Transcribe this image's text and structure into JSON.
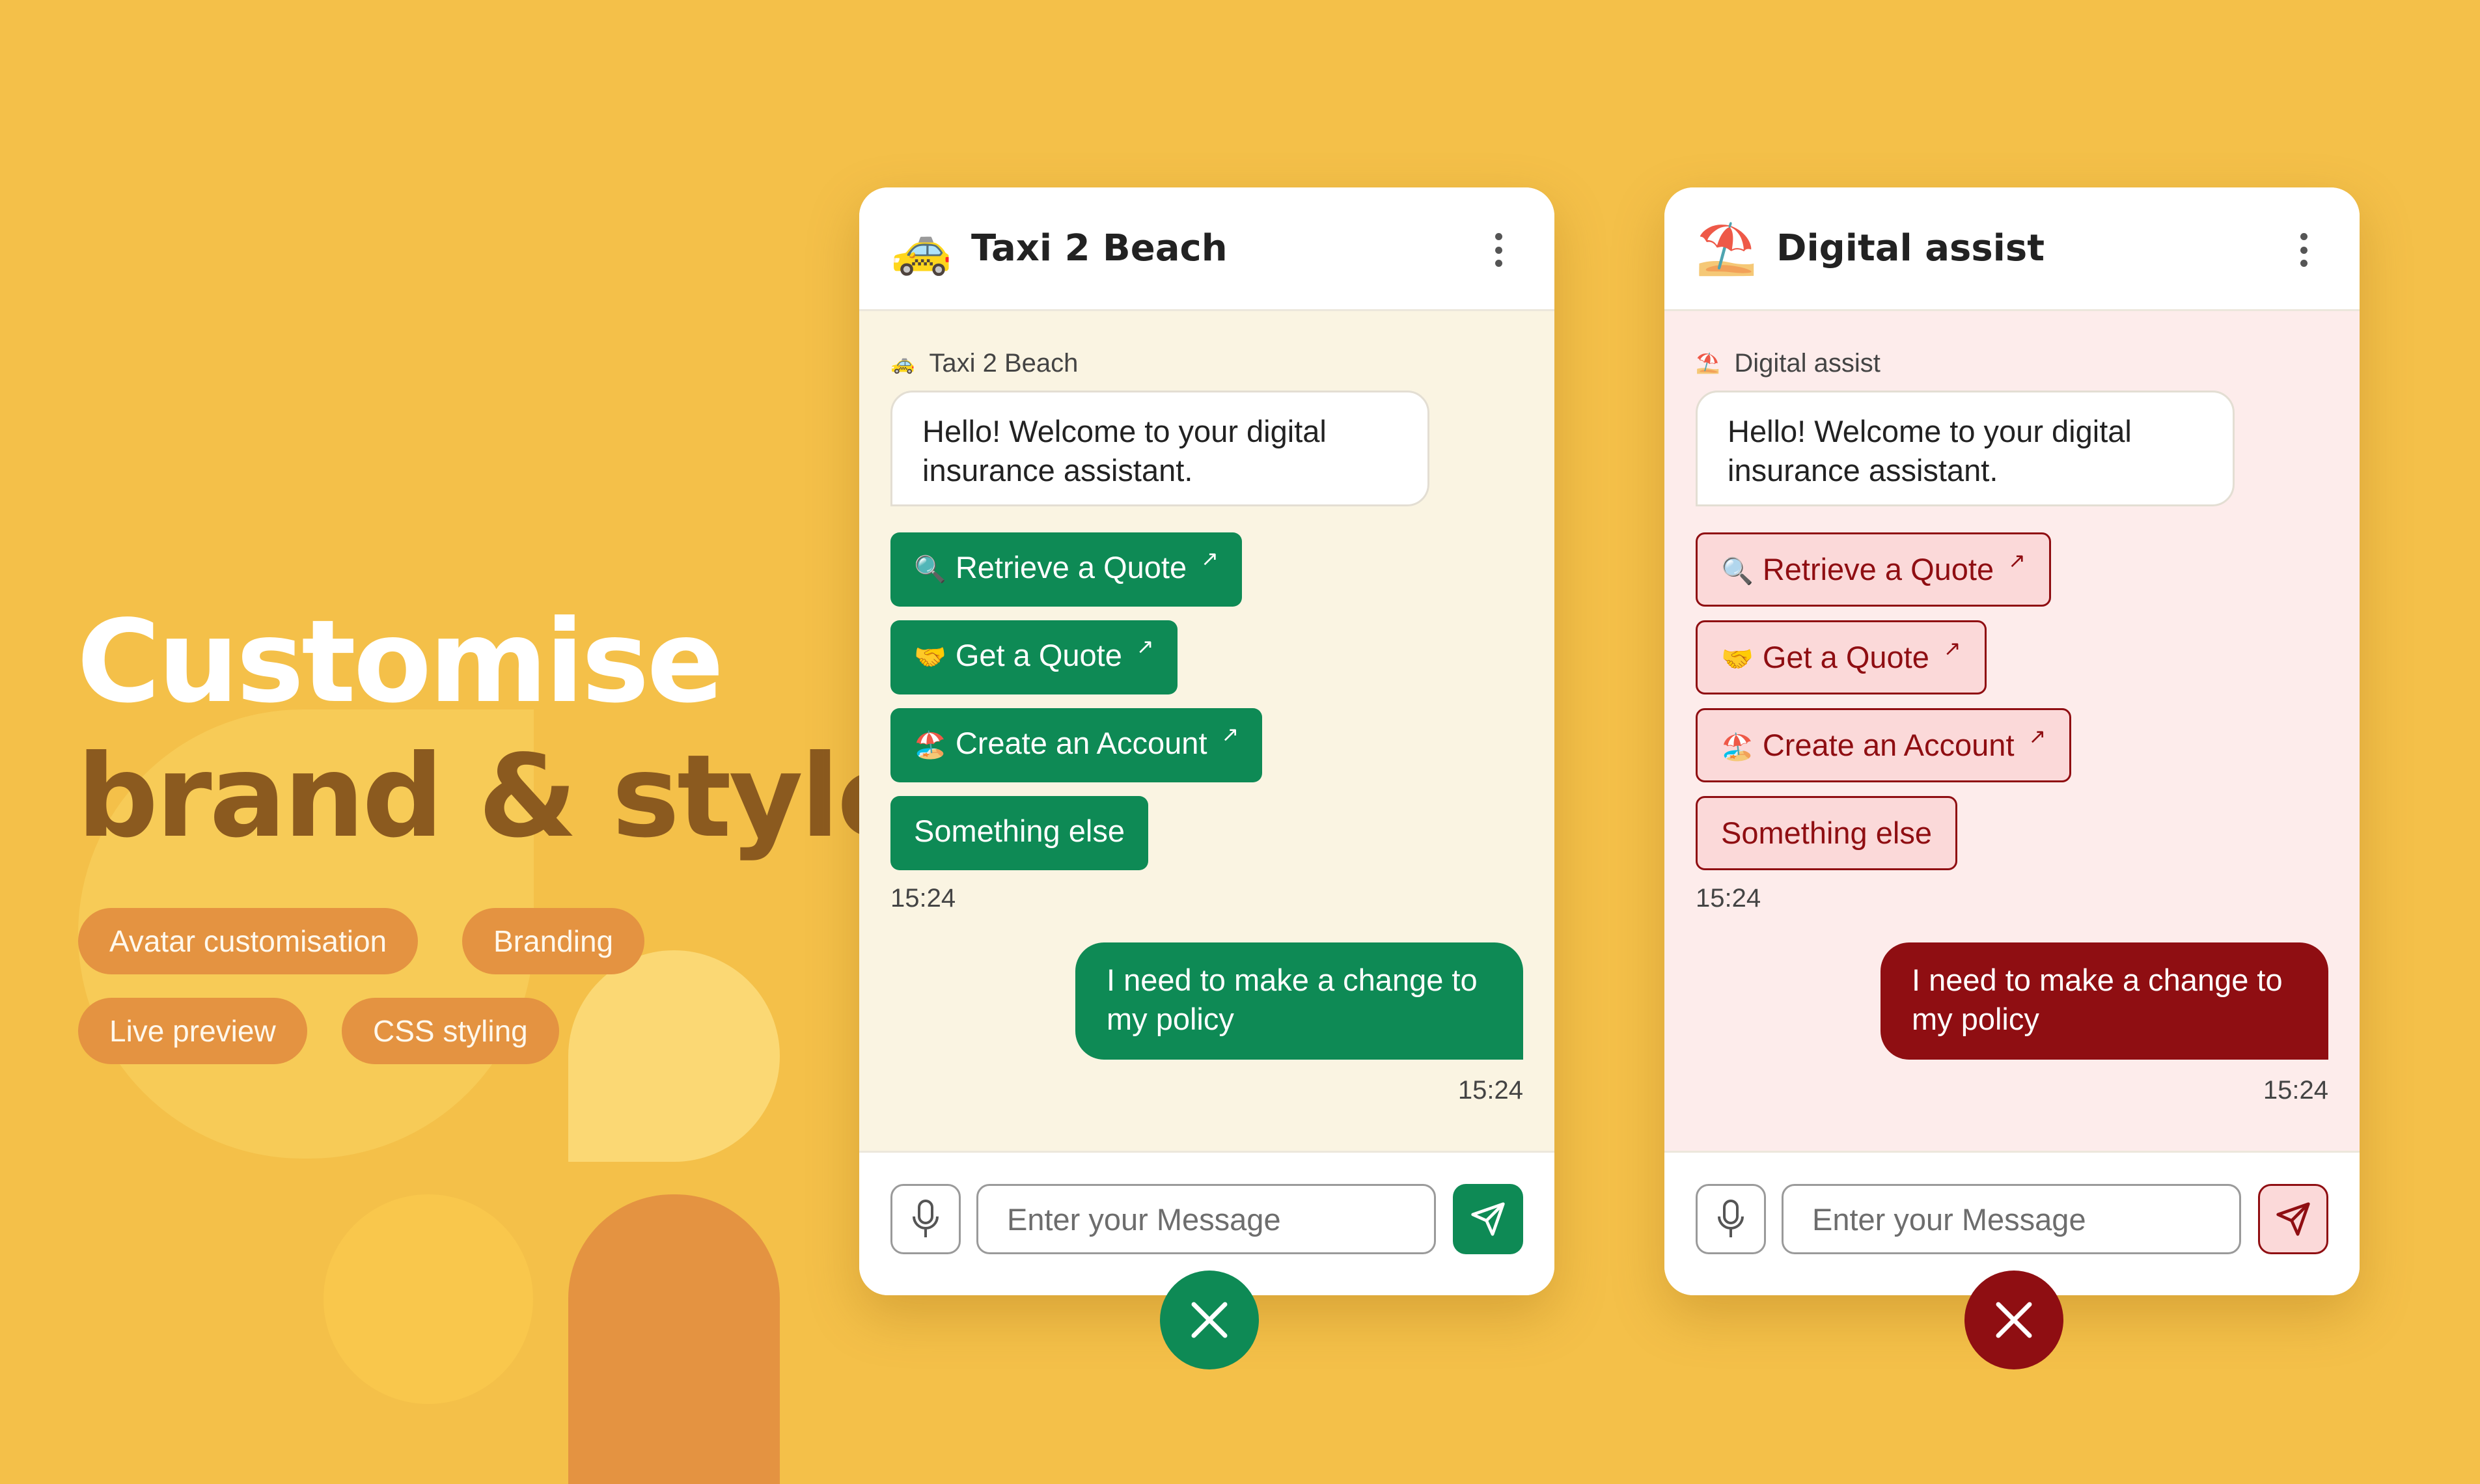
{
  "headline": {
    "line1": "Customise",
    "line2": "brand & style"
  },
  "tags": [
    "Avatar customisation",
    "Branding",
    "Live preview",
    "CSS styling"
  ],
  "colors": {
    "background": "#f4c049",
    "green_accent": "#0e8a55",
    "green_body": "#faf4e2",
    "red_accent": "#8f0e12",
    "red_light": "#fbd9d9",
    "red_body": "#fdeceb"
  },
  "widgets": [
    {
      "title": "Taxi 2 Beach",
      "avatar": "🚕",
      "avatar_icon": "taxi-icon",
      "sender_name": "Taxi 2 Beach",
      "bot_message": "Hello! Welcome to your digital insurance assistant.",
      "quick_replies": [
        {
          "emoji": "🔍",
          "label": "Retrieve a Quote",
          "external": true
        },
        {
          "emoji": "🤝",
          "label": "Get a Quote",
          "external": true
        },
        {
          "emoji": "🏖️",
          "label": "Create an Account",
          "external": true
        },
        {
          "emoji": "",
          "label": "Something else",
          "external": false
        }
      ],
      "bot_time": "15:24",
      "user_message": "I need to make a change to my policy",
      "user_time": "15:24",
      "input_placeholder": "Enter your Message"
    },
    {
      "title": "Digital assist",
      "avatar": "⛱️",
      "avatar_icon": "beach-umbrella-icon",
      "sender_name": "Digital assist",
      "bot_message": "Hello! Welcome to your digital insurance assistant.",
      "quick_replies": [
        {
          "emoji": "🔍",
          "label": "Retrieve a Quote",
          "external": true
        },
        {
          "emoji": "🤝",
          "label": "Get a Quote",
          "external": true
        },
        {
          "emoji": "🏖️",
          "label": "Create an Account",
          "external": true
        },
        {
          "emoji": "",
          "label": "Something else",
          "external": false
        }
      ],
      "bot_time": "15:24",
      "user_message": "I need to make a change to my policy",
      "user_time": "15:24",
      "input_placeholder": "Enter your Message"
    }
  ]
}
